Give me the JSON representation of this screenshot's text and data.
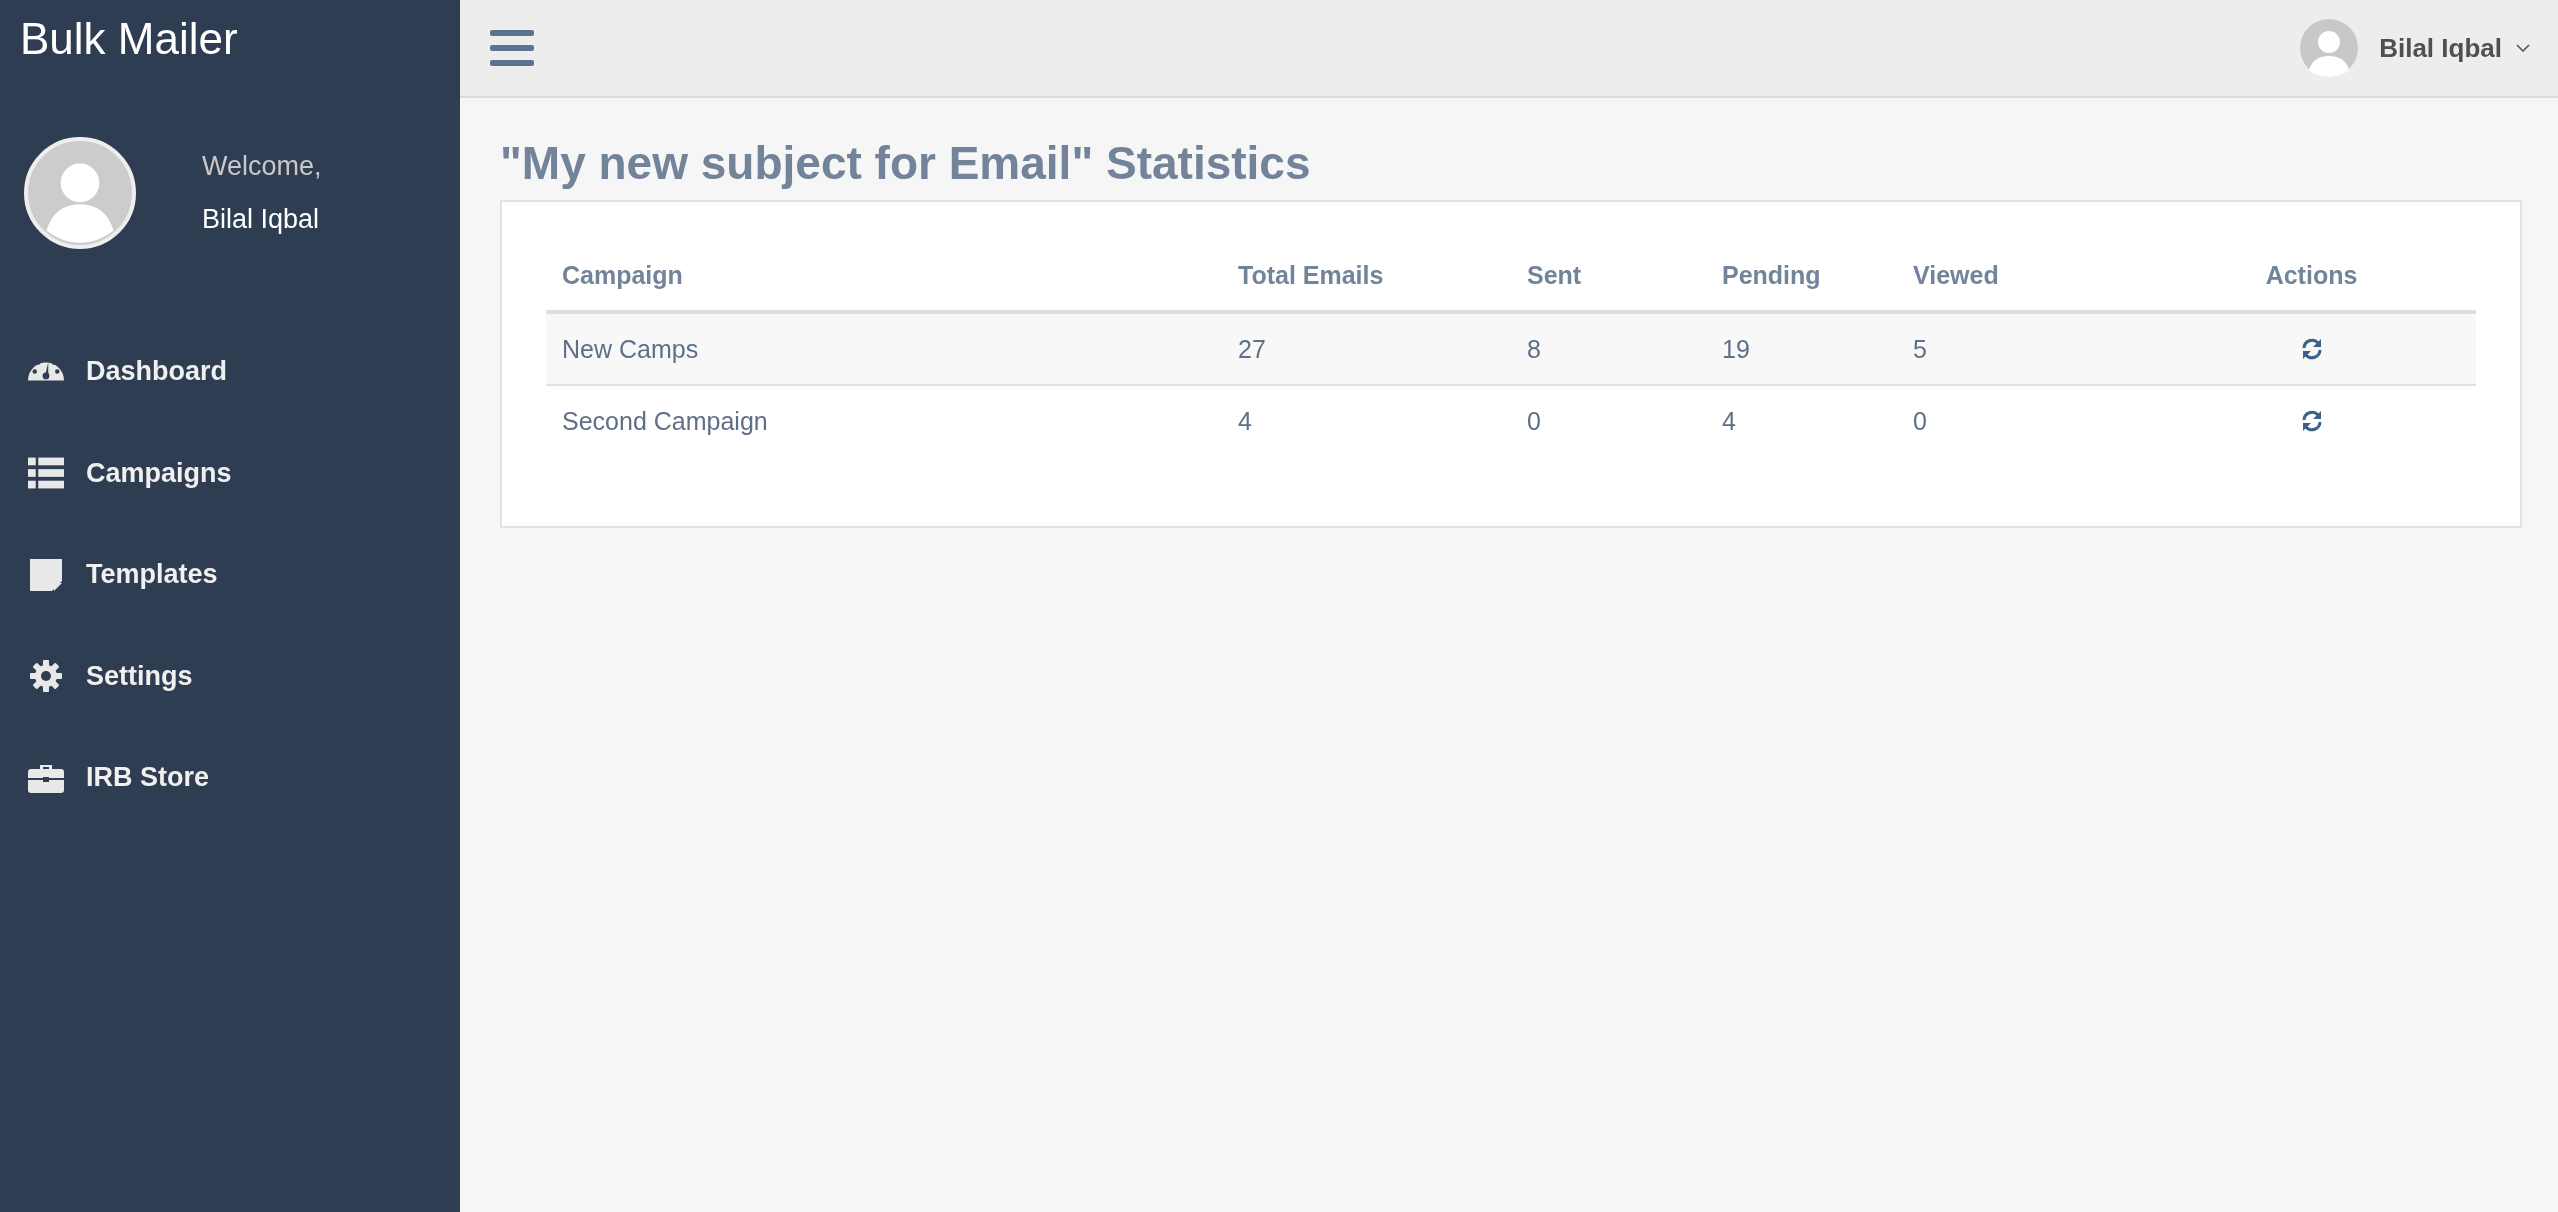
{
  "brand": "Bulk Mailer",
  "profile": {
    "greeting": "Welcome,",
    "name": "Bilal Iqbal"
  },
  "nav": [
    {
      "label": "Dashboard",
      "kind": "dashboard"
    },
    {
      "label": "Campaigns",
      "kind": "list"
    },
    {
      "label": "Templates",
      "kind": "note"
    },
    {
      "label": "Settings",
      "kind": "gear"
    },
    {
      "label": "IRB Store",
      "kind": "briefcase"
    }
  ],
  "topbar": {
    "user": "Bilal Iqbal"
  },
  "page_title": "\"My new subject for Email\" Statistics",
  "table": {
    "columns": [
      "Campaign",
      "Total Emails",
      "Sent",
      "Pending",
      "Viewed",
      "Actions"
    ],
    "rows": [
      {
        "cells": [
          "New Camps",
          "27",
          "8",
          "19",
          "5"
        ]
      },
      {
        "cells": [
          "Second Campaign",
          "4",
          "0",
          "4",
          "0"
        ]
      }
    ]
  }
}
